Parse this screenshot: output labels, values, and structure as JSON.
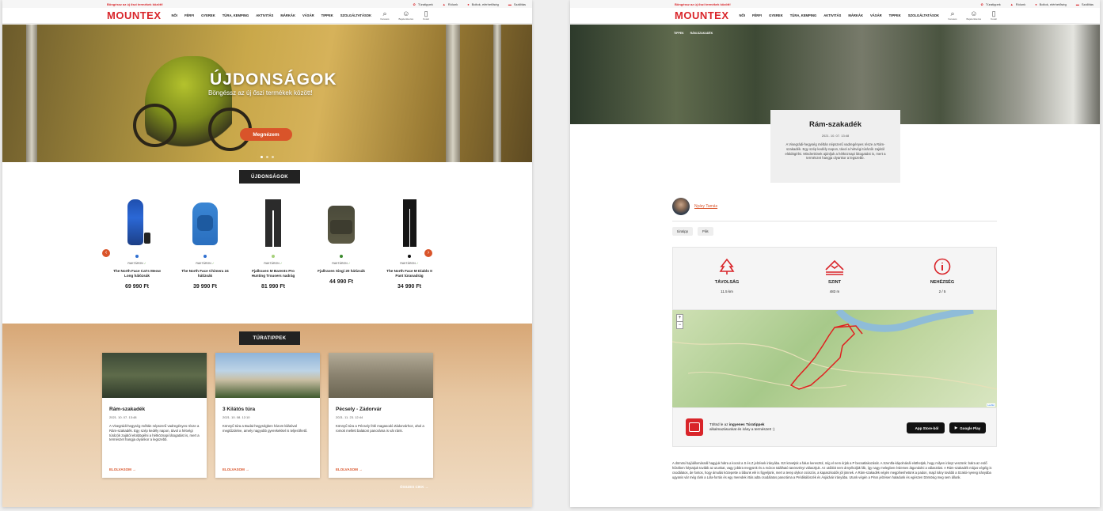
{
  "brand": {
    "logo": "MOUNTEX",
    "accent": "#d9252a",
    "button": "#d9542a"
  },
  "topbar": {
    "promo": "Böngéssz az új őszi termékek között!",
    "links": [
      {
        "icon": "gift-icon",
        "label": "Túratippek"
      },
      {
        "icon": "mountain-icon",
        "label": "Rólunk"
      },
      {
        "icon": "pin-icon",
        "label": "Boltok, elérhetőség"
      },
      {
        "icon": "truck-icon",
        "label": "Szállítás"
      }
    ]
  },
  "nav": [
    "NŐI",
    "FÉRFI",
    "GYEREK",
    "TÚRA, KEMPING",
    "AKTIVITÁS",
    "MÁRKÁK",
    "VÁSÁR",
    "TIPPEK",
    "SZOLGÁLTATÁSOK"
  ],
  "header_icons": [
    {
      "icon": "search-icon",
      "label": "Keresés"
    },
    {
      "icon": "user-icon",
      "label": "Bejelentkezés"
    },
    {
      "icon": "cart-icon",
      "label": "Kosár"
    }
  ],
  "left": {
    "hero": {
      "title": "ÚJDONSÁGOK",
      "subtitle": "Böngéssz az új őszi termékek között!",
      "cta": "Megnézem"
    },
    "new_section": "ÚJDONSÁGOK",
    "products": [
      {
        "name": "The North Face Cat's Meow Long hálózsák",
        "price": "69 990 Ft",
        "stock": "RAKTÁRON",
        "color": "#2f6fd1"
      },
      {
        "name": "The North Face Chimera 24 hátizsák",
        "price": "39 990 Ft",
        "stock": "RAKTÁRON",
        "color": "#2f6fd1"
      },
      {
        "name": "Fjallraven M Barents Pro Hunting Trousers nadrág",
        "price": "81 990 Ft",
        "stock": "RAKTÁRON",
        "color": "#a6d07a"
      },
      {
        "name": "Fjallraven Singi 20 hátizsák",
        "price": "44 990 Ft",
        "stock": "RAKTÁRON",
        "color": "#3c8a2e"
      },
      {
        "name": "The North Face M Diablo II Pant túranadrág",
        "price": "34 990 Ft",
        "stock": "RAKTÁRON",
        "color": "#111111"
      }
    ],
    "tips_section": "TÚRATIPPEK",
    "cards": [
      {
        "title": "Rám-szakadék",
        "date": "2021. 10. 07. 13:48",
        "text": "A Visegrádi-hegység méltán népszerű vadregényes része a Rám-szakadék. Egy szép kedély napon, távol a hétvégi túrázók zajától elüldögélni a hétköznapi látogatást is, mert a természet hangja olyankor a legszebb.",
        "more": "ELOLVASOM →"
      },
      {
        "title": "3 Kilátós túra",
        "date": "2021. 10. 08. 12:10",
        "text": "Könnyű túra a Budai-hegységben három kilátóval megtűzdelve, amely nagyobb gyerekekkel is teljesíthető.",
        "more": "ELOLVASOM →"
      },
      {
        "title": "Pécsely - Zádorvár",
        "date": "2021. 11. 23. 12:44",
        "text": "Könnyű túra a Pécsely fölé magasodó Zádorvárhoz, ahol a romok mellett balatoni panoráma is vár ránk.",
        "more": "ELOLVASOM →"
      }
    ],
    "all": "ÖSSZES CIKK →"
  },
  "right": {
    "breadcrumb": [
      "TIPPEK",
      "RÁM-SZAKADÉK"
    ],
    "title": "Rám-szakadék",
    "date": "2021. 10. 07. 13:48",
    "intro": "A Visegrádi-hegység méltán népszerű vadregényes része a Rám-szakadék. Egy szép kedély napon, távol a hétvégi túrázók zajától elüldögélni. Mindenkinek ajánljuk a hétköznapi látogatást is, mert a természet hangja olyankor a legszebb.",
    "author": "Nyáry Tamás",
    "tags": [
      "túratipp",
      "Pilis"
    ],
    "stats": [
      {
        "icon": "tree-icon",
        "label": "TÁVOLSÁG",
        "value": "11.5 km"
      },
      {
        "icon": "mountain-level-icon",
        "label": "SZINT",
        "value": "483 m"
      },
      {
        "icon": "info-icon",
        "label": "NEHÉZSÉG",
        "value": "2 / 5"
      }
    ],
    "map": {
      "zoom_in": "+",
      "zoom_out": "−",
      "credit": "Leaflet"
    },
    "app": {
      "line1_pre": "Töltsd le az ",
      "line1_bold": "ingyenes Túratippek",
      "line2": "alkalmazásunkat és irány a természet! :)",
      "appstore": "App Store-ból",
      "googleplay": "Google Play"
    },
    "body": "A dömösi hajóállomásnál hagyjuk hátra a kocsit a S és Z jelzések irányába. Ezt követjük a falun keresztül, míg el nem érjük a P becsatlakozását. A Szentfa-kápolnánál elüthetjük, hogy milyen irányt veszünk: balra az erdő hűsében folytatjuk tovább az utunkat, vagy jobbra megyünk és a mózon található tanösvényt választjuk. Az utóbbit nem árnyékolják fák, így nagy melegben érdemes átgondolni a választást. A Rám-szakadék május végéig is csodálatos, de fontos, hogy ámulás közepette a lábunk elé is figyeljünk, mert a terep olykor csúszós, a kapaszkodók jól jönnek. A Rám-szakadék végén megpihenhetünk a padon, majd irány tovább a Szakó-nyereg irányába ugyanis vár még ránk a Lóla-forrás és egy meredek irtás adta csodálatos panoráma a Prédikálószék és Ásjádvár irányába. Utunk végén a Piros jelzésen haladunk és egészen Dömösig meg sem állunk."
  }
}
